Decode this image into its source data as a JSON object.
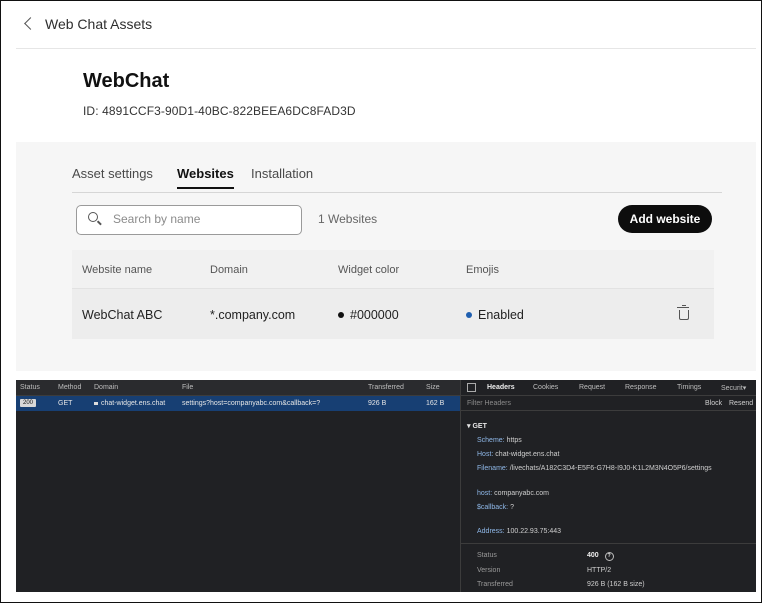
{
  "breadcrumb": {
    "back_label": "Web Chat Assets"
  },
  "asset": {
    "title": "WebChat",
    "id": "ID: 4891CCF3-90D1-40BC-822BEEA6DC8FAD3D"
  },
  "tabs": [
    {
      "label": "Asset settings"
    },
    {
      "label": "Websites"
    },
    {
      "label": "Installation"
    }
  ],
  "search": {
    "placeholder": "Search by name"
  },
  "count_label": "1 Websites",
  "add_button": "Add website",
  "table": {
    "columns": [
      "Website name",
      "Domain",
      "Widget color",
      "Emojis"
    ],
    "rows": [
      {
        "name": "WebChat ABC",
        "domain": "*.company.com",
        "color": "#000000",
        "emojis": "Enabled"
      }
    ]
  },
  "devtools": {
    "columns": [
      "Status",
      "Method",
      "Domain",
      "File",
      "Transferred",
      "Size"
    ],
    "request": {
      "status": "200",
      "method": "GET",
      "domain": "chat-widget.ens.chat",
      "file": "settings?host=companyabc.com&callback=?",
      "transferred": "926 B",
      "size": "162 B"
    },
    "detail_tabs": [
      "Headers",
      "Cookies",
      "Request",
      "Response",
      "Timings",
      "Securit▾"
    ],
    "filter_placeholder": "Filter Headers",
    "block_label": "Block",
    "resend_label": "Resend",
    "section": "GET",
    "scheme_label": "Scheme:",
    "scheme_value": "https",
    "host_label": "Host:",
    "host_value": "chat-widget.ens.chat",
    "filename_label": "Filename:",
    "filename_value": "/livechats/A182C3D4-E5F6-G7H8-I9J0-K1L2M3N4O5P6/settings",
    "param_host_label": "host:",
    "param_host_value": "companyabc.com",
    "param_callback_label": "$callback:",
    "param_callback_value": "?",
    "address_label": "Address:",
    "address_value": "100.22.93.75:443",
    "status_label": "Status",
    "status_value": "400",
    "version_label": "Version",
    "version_value": "HTTP/2",
    "transferred_label": "Transferred",
    "transferred_value": "926 B (162 B size)"
  },
  "colors": {
    "accent_blue": "#1f5fb0",
    "dot_black": "#111111",
    "button_bg": "#0d0d0d"
  }
}
